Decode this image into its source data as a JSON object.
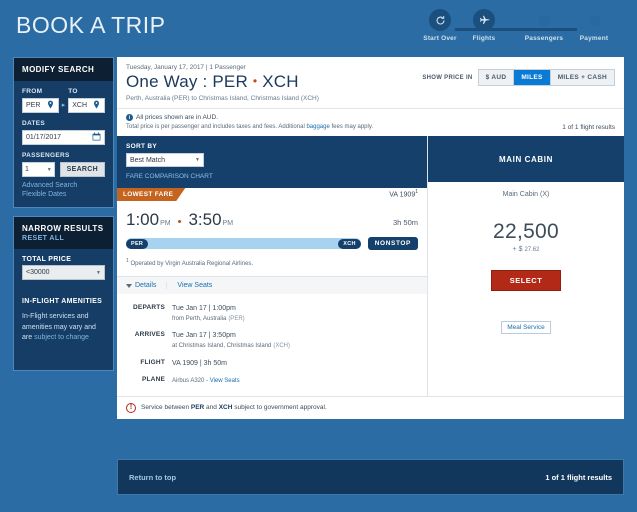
{
  "brand": "BOOK A TRIP",
  "steps": [
    {
      "label": "Start Over",
      "icon": "refresh-icon",
      "state": "action"
    },
    {
      "label": "Flights",
      "icon": "plane-icon",
      "state": "active"
    },
    {
      "label": "Passengers",
      "icon": "dot-icon",
      "state": "upcoming"
    },
    {
      "label": "Payment",
      "icon": "dot-icon",
      "state": "upcoming"
    }
  ],
  "sidebar": {
    "modify": {
      "title": "MODIFY SEARCH",
      "from_label": "FROM",
      "from_value": "PER",
      "to_label": "TO",
      "to_value": "XCH",
      "dates_label": "DATES",
      "dates_value": "01/17/2017",
      "passengers_label": "PASSENGERS",
      "passengers_value": "1",
      "search_label": "SEARCH",
      "advanced_search": "Advanced Search",
      "flexible_dates": "Flexible Dates"
    },
    "narrow": {
      "title": "NARROW RESULTS",
      "reset": "RESET ALL",
      "total_price_label": "TOTAL PRICE",
      "total_price_value": "<30000",
      "amenities_label": "IN-FLIGHT AMENITIES",
      "amenities_text": "In-Flight services and amenities may vary and are ",
      "amenities_link": "subject to change"
    }
  },
  "header": {
    "meta": "Tuesday, January 17, 2017 | 1 Passenger",
    "title_prefix": "One Way : PER",
    "title_suffix": "XCH",
    "route": "Perth, Australia (PER) to Christmas Island, Christmas Island (XCH)",
    "show_price_in": "SHOW PRICE IN",
    "currency_options": [
      "$ AUD",
      "MILES",
      "MILES + CASH"
    ],
    "currency_selected": "MILES",
    "note_currency": "All prices shown are in AUD.",
    "note_total_a": "Total price is per passenger and includes taxes and fees. Additional ",
    "note_total_link": "baggage",
    "note_total_b": " fees may apply.",
    "results_count": "1 of 1 flight results"
  },
  "sort": {
    "label": "SORT BY",
    "value": "Best Match",
    "fare_chart_link": "FARE COMPARISON CHART"
  },
  "flight": {
    "badge": "LOWEST FARE",
    "number": "VA 1909",
    "depart_time": "1:00",
    "depart_ampm": "PM",
    "arrive_time": "3:50",
    "arrive_ampm": "PM",
    "duration": "3h 50m",
    "origin": "PER",
    "destination": "XCH",
    "stops": "NONSTOP",
    "operated_by": "Operated by Virgin Australia Regional Airlines.",
    "details_label": "Details",
    "view_seats_label": "View Seats",
    "detail_rows": [
      {
        "label": "DEPARTS",
        "line1": "Tue Jan 17 | 1:00pm",
        "line2": "from Perth, Australia",
        "code": "(PER)"
      },
      {
        "label": "ARRIVES",
        "line1": "Tue Jan 17 | 3:50pm",
        "line2": "at Christmas Island, Christmas Island",
        "code": "(XCH)"
      },
      {
        "label": "FLIGHT",
        "line1": "VA 1909 | 3h 50m",
        "line2": "",
        "code": ""
      },
      {
        "label": "PLANE",
        "line1": "Airbus A320 - ",
        "line2": "",
        "code": "",
        "link": "View Seats"
      }
    ]
  },
  "cabin": {
    "header": "MAIN CABIN",
    "name": "Main Cabin (X)",
    "miles": "22,500",
    "plus_currency": "+ $",
    "plus_amount": "27.62",
    "select_label": "SELECT",
    "meal_link": "Meal Service"
  },
  "warning": {
    "prefix": "Service between ",
    "origin": "PER",
    "middle": " and ",
    "destination": "XCH",
    "suffix": " subject to government approval.",
    "icon": "!"
  },
  "footer": {
    "return_to_top": "Return to top",
    "results_count": "1 of 1 flight results"
  },
  "colors": {
    "page_blue": "#2a6ca3",
    "navy": "#14406b",
    "accent_orange": "#c4641e",
    "select_red": "#b22a17",
    "active_blue": "#0a7bd4"
  }
}
